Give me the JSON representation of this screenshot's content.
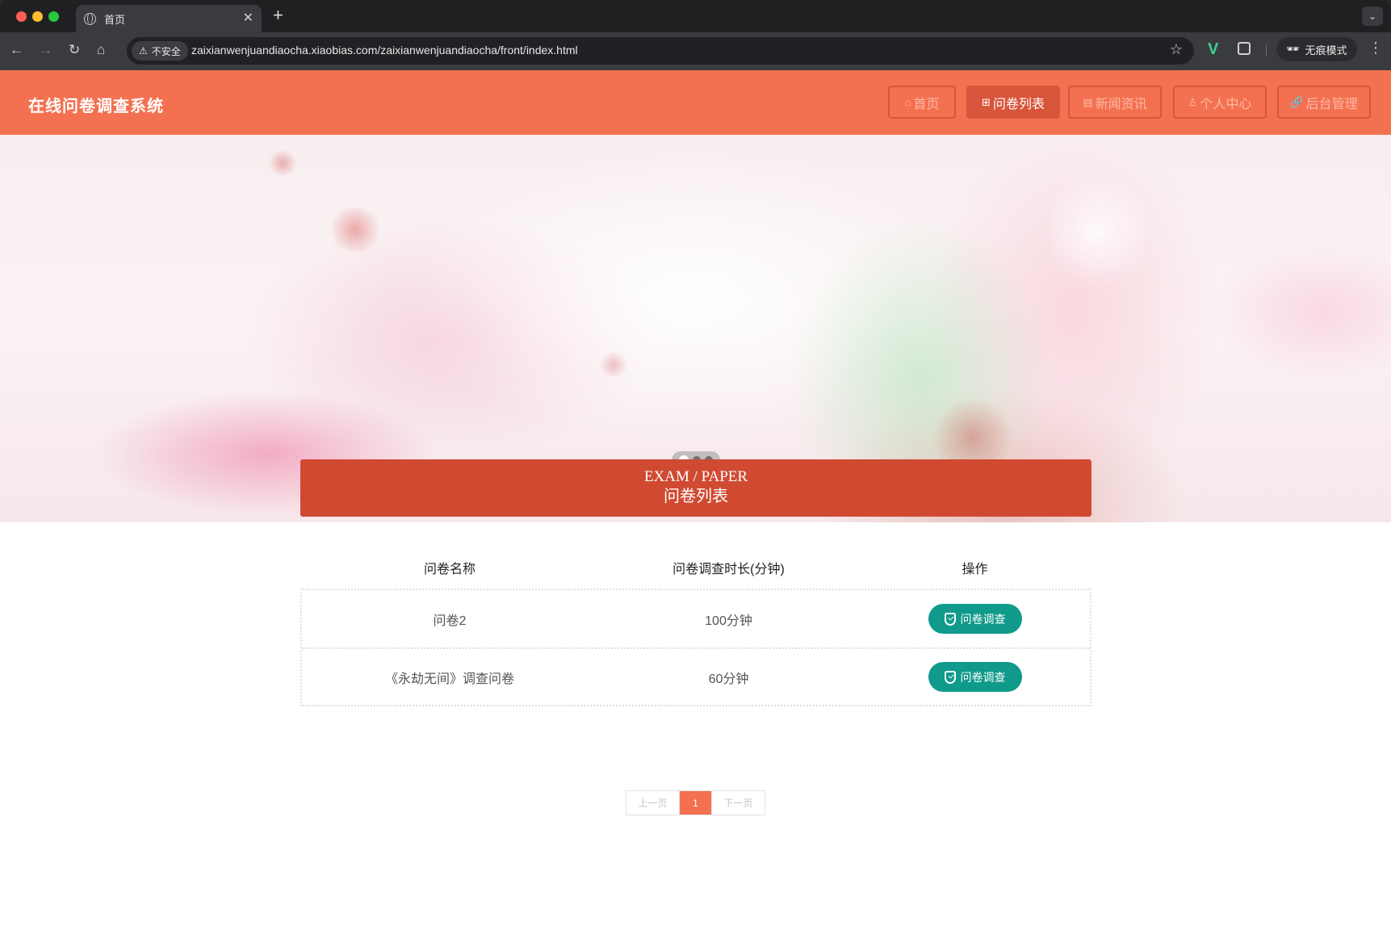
{
  "browser": {
    "tab_title": "首页",
    "new_tab": "+",
    "tab_close": "✕",
    "insecure_label": "不安全",
    "url": "zaixianwenjuandiaocha.xiaobias.com/zaixianwenjuandiaocha/front/index.html",
    "incognito_label": "无痕模式"
  },
  "site": {
    "title": "在线问卷调查系统",
    "nav": [
      {
        "label": "首页",
        "icon": "home-icon",
        "active": false
      },
      {
        "label": "问卷列表",
        "icon": "gift-icon",
        "active": true
      },
      {
        "label": "新闻资讯",
        "icon": "document-icon",
        "active": false
      },
      {
        "label": "个人中心",
        "icon": "user-icon",
        "active": false
      },
      {
        "label": "后台管理",
        "icon": "link-icon",
        "active": false
      }
    ]
  },
  "carousel": {
    "slides": 3,
    "active_slide": 1
  },
  "section": {
    "title_en": "EXAM / PAPER",
    "title_cn": "问卷列表"
  },
  "table": {
    "headers": [
      "问卷名称",
      "问卷调查时长(分钟)",
      "操作"
    ],
    "rows": [
      {
        "name": "问卷2",
        "duration": "100分钟",
        "action": "问卷调查"
      },
      {
        "name": "《永劫无间》调查问卷",
        "duration": "60分钟",
        "action": "问卷调查"
      }
    ]
  },
  "pagination": {
    "prev": "上一页",
    "current": "1",
    "next": "下一页"
  },
  "colors": {
    "header": "#f37151",
    "nav_active": "#d8543a",
    "section_head": "#d04a32",
    "action_button": "#0f9a8b"
  }
}
